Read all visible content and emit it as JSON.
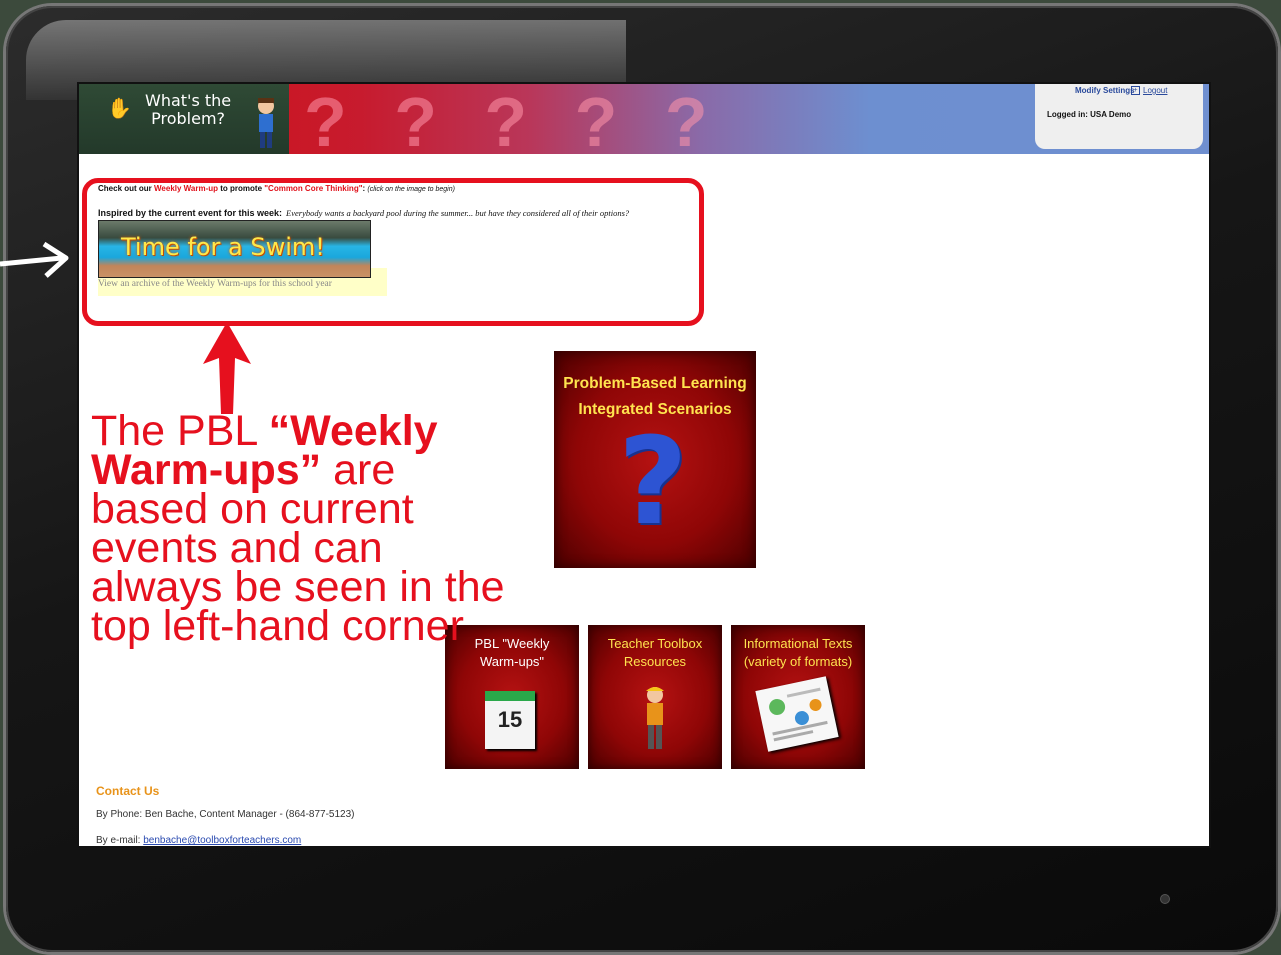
{
  "header": {
    "logo_text_line1": "What's the",
    "logo_text_line2": "Problem?",
    "decor_qmarks": "? ? ? ? ?",
    "modify_settings": "Modify Settings",
    "logout": "Logout",
    "logged_in": "Logged in: USA Demo"
  },
  "warmup": {
    "line_prefix": "Check out our ",
    "link_label": "Weekly Warm-up",
    "line_mid": " to promote ",
    "highlight": "\"Common Core Thinking\"",
    "line_suffix": ": ",
    "hint": "(click on the image to begin)",
    "inspired_label": "Inspired by the current event for this week:",
    "inspired_text": "Everybody wants a backyard pool during the summer... but have they considered all of their options?",
    "image_title": "Time for a Swim!",
    "archive_link": "View an archive of the Weekly Warm-ups for this school year"
  },
  "tiles": {
    "main_line1": "Problem-Based Learning",
    "main_line2": "Integrated Scenarios",
    "main_icon": "question-mark-figure-icon",
    "items": [
      {
        "line1": "PBL \"Weekly",
        "line2": "Warm-ups\"",
        "icon": "calendar-icon",
        "cal_day": "15"
      },
      {
        "line1": "Teacher Toolbox",
        "line2": "Resources",
        "icon": "worker-figure-icon"
      },
      {
        "line1": "Informational Texts",
        "line2": "(variety of formats)",
        "icon": "document-icon"
      }
    ]
  },
  "contact": {
    "title": "Contact Us",
    "phone": "By Phone: Ben Bache, Content Manager - (864-877-5123)",
    "email_label": "By e-mail: ",
    "email": "benbache@toolboxforteachers.com"
  },
  "annotation": {
    "text_pre": "The PBL ",
    "text_bold": "“Weekly Warm-ups”",
    "text_post": " are based on current events and can always be seen in the top left-hand corner"
  },
  "colors": {
    "annotation_red": "#e6101e",
    "tile_red": "#8f0606",
    "contact_orange": "#e8931a"
  }
}
